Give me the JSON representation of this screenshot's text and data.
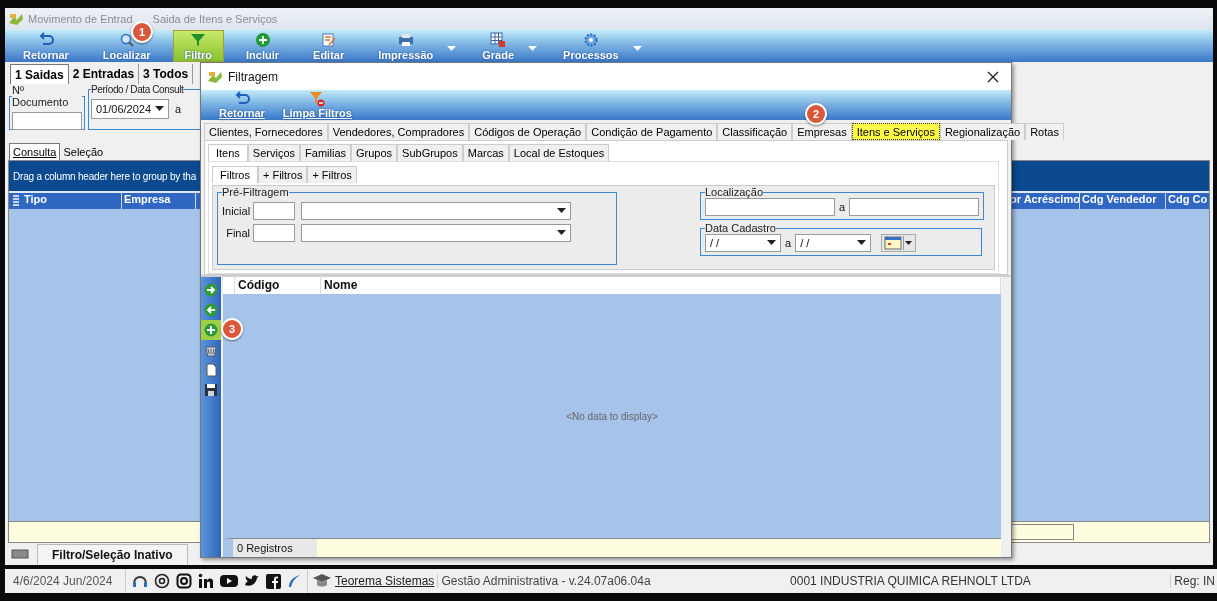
{
  "main_window": {
    "title_parts": [
      "Movimento de Entrad",
      "Saida de Itens e Serviços"
    ],
    "toolbar": [
      {
        "label": "Retornar",
        "kind": "back",
        "selected": false,
        "dropdown": false
      },
      {
        "label": "Localizar",
        "kind": "search",
        "selected": false,
        "dropdown": false
      },
      {
        "label": "Filtro",
        "kind": "filter",
        "selected": true,
        "dropdown": false
      },
      {
        "label": "Incluir",
        "kind": "add",
        "selected": false,
        "dropdown": false
      },
      {
        "label": "Editar",
        "kind": "edit",
        "selected": false,
        "dropdown": false
      },
      {
        "label": "Impressão",
        "kind": "print",
        "selected": false,
        "dropdown": true
      },
      {
        "label": "Grade",
        "kind": "grid",
        "selected": false,
        "dropdown": true
      },
      {
        "label": "Processos",
        "kind": "gear",
        "selected": false,
        "dropdown": true
      }
    ],
    "record_tabs": [
      {
        "label": "1 Saidas",
        "selected": true
      },
      {
        "label": "2 Entradas",
        "selected": false
      },
      {
        "label": "3 Todos",
        "selected": false
      }
    ],
    "document_field": {
      "label": "Nº Documento"
    },
    "period": {
      "label": "Período / Data Consult",
      "start": "01/06/2024",
      "separator": "a"
    },
    "view_tabs": [
      {
        "label": "Consulta",
        "selected": true
      },
      {
        "label": "Seleção",
        "selected": false
      }
    ],
    "group_panel": "Drag a column header here to group by tha",
    "columns_left": [
      "Tipo",
      "Empresa"
    ],
    "columns_right": [
      "or Acréscimo",
      "Cdg Vendedor",
      "Cdg Co"
    ],
    "status": "Filtro/Seleção Inativo"
  },
  "bottom_bar": {
    "date": "4/6/2024 Jun/2024",
    "link": "Teorema Sistemas",
    "version": "Gestão Administrativa - v.24.07a06.04a",
    "company": "0001 INDUSTRIA QUIMICA REHNOLT LTDA",
    "register": "Reg: IN"
  },
  "dialog": {
    "title": "Filtragem",
    "toolbar": [
      {
        "label": "Retornar",
        "kind": "back"
      },
      {
        "label": "Limpa Filtros",
        "kind": "clear-filter"
      }
    ],
    "category_tabs": [
      {
        "label": "Clientes, Fornecedores",
        "selected": false
      },
      {
        "label": "Vendedores, Compradores",
        "selected": false
      },
      {
        "label": "Códigos de Operação",
        "selected": false
      },
      {
        "label": "Condição de Pagamento",
        "selected": false
      },
      {
        "label": "Classificação",
        "selected": false
      },
      {
        "label": "Empresas",
        "selected": false
      },
      {
        "label": "Itens e Serviços",
        "selected": true
      },
      {
        "label": "Regionalização",
        "selected": false
      },
      {
        "label": "Rotas",
        "selected": false
      }
    ],
    "sub_tabs": [
      {
        "label": "Itens",
        "selected": true
      },
      {
        "label": "Serviços",
        "selected": false
      },
      {
        "label": "Familias",
        "selected": false
      },
      {
        "label": "Grupos",
        "selected": false
      },
      {
        "label": "SubGrupos",
        "selected": false
      },
      {
        "label": "Marcas",
        "selected": false
      },
      {
        "label": "Local de Estoques",
        "selected": false
      }
    ],
    "filter_tabs": [
      {
        "label": "Filtros",
        "selected": true
      },
      {
        "label": "+ Filtros",
        "selected": false
      },
      {
        "label": "+ Filtros",
        "selected": false
      }
    ],
    "prefilter": {
      "title": "Pré-Filtragem",
      "rows": [
        {
          "label": "Inicial"
        },
        {
          "label": "Final"
        }
      ]
    },
    "location": {
      "title": "Localização",
      "separator": "a"
    },
    "register_date": {
      "title": "Data Cadastro",
      "start": "/ /",
      "end": "/ /",
      "separator": "a"
    },
    "side_tools": [
      {
        "kind": "next",
        "highlighted": false
      },
      {
        "kind": "previous",
        "highlighted": false
      },
      {
        "kind": "add",
        "highlighted": true
      },
      {
        "kind": "basket",
        "highlighted": false
      },
      {
        "kind": "document",
        "highlighted": false
      },
      {
        "kind": "save",
        "highlighted": false
      }
    ],
    "columns": [
      "Código",
      "Nome"
    ],
    "empty_text": "<No data to display>",
    "footer": "0 Registros"
  },
  "callouts": [
    "1",
    "2",
    "3"
  ]
}
